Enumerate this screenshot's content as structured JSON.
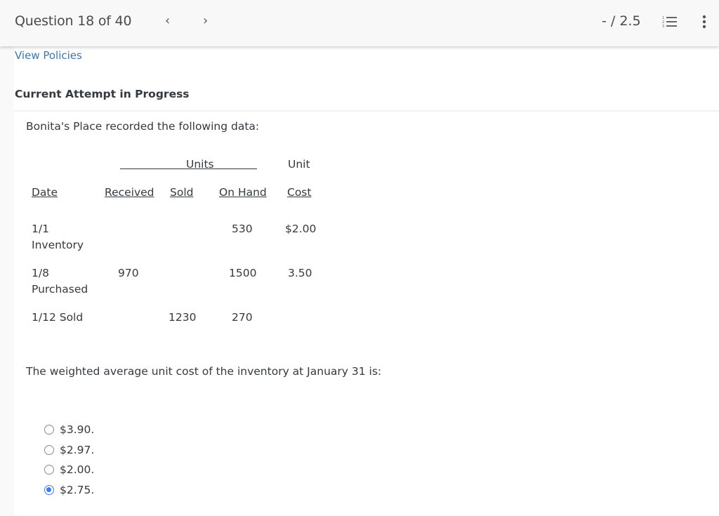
{
  "header": {
    "question_title": "Question 18 of 40",
    "prev_icon": "‹",
    "next_icon": "›",
    "score": "- / 2.5",
    "list_icon": "numbered-list-icon",
    "more_icon": "more-vertical-icon"
  },
  "links": {
    "view_policies": "View Policies"
  },
  "attempt_label": "Current Attempt in Progress",
  "intro": "Bonita's Place recorded the following data:",
  "table": {
    "group_header": "Units",
    "unit_header": "Unit",
    "columns": [
      "Date",
      "Received",
      "Sold",
      "On Hand",
      "Cost"
    ],
    "rows": [
      {
        "date_line1": "1/1",
        "date_line2": "Inventory",
        "received": "",
        "sold": "",
        "on_hand": "530",
        "cost": "$2.00"
      },
      {
        "date_line1": "1/8",
        "date_line2": "Purchased",
        "received": "970",
        "sold": "",
        "on_hand": "1500",
        "cost": "3.50"
      },
      {
        "date_line1": "1/12 Sold",
        "date_line2": "",
        "received": "",
        "sold": "1230",
        "on_hand": "270",
        "cost": ""
      }
    ]
  },
  "question": "The weighted average unit cost of the inventory at January 31 is:",
  "options": [
    {
      "label": "$3.90.",
      "selected": false
    },
    {
      "label": "$2.97.",
      "selected": false
    },
    {
      "label": "$2.00.",
      "selected": false
    },
    {
      "label": "$2.75.",
      "selected": true
    }
  ],
  "colors": {
    "accent": "#3a7bf0",
    "link": "#3a78b0",
    "text": "#333a40"
  }
}
